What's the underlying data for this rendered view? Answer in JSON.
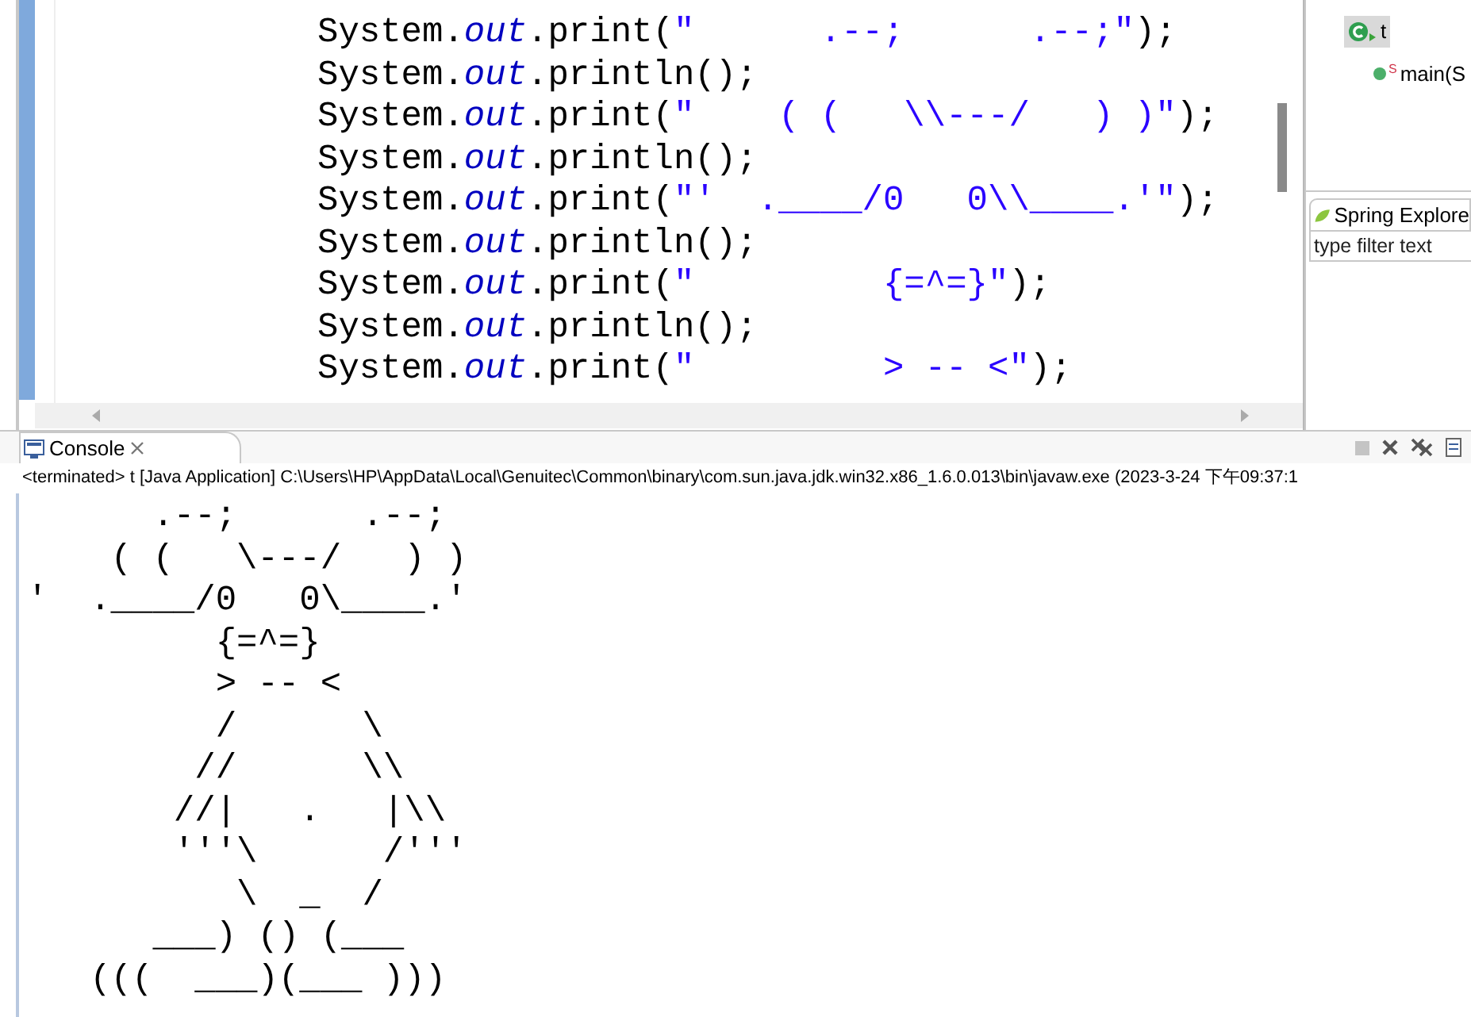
{
  "editor": {
    "lines": [
      {
        "kind": "print",
        "receiver": "System.",
        "field": "out",
        "method": ".print(",
        "literal": "\"      .--;      .--;\"",
        "end": ");"
      },
      {
        "kind": "println",
        "receiver": "System.",
        "field": "out",
        "method": ".println();"
      },
      {
        "kind": "print",
        "receiver": "System.",
        "field": "out",
        "method": ".print(",
        "literal": "\"    ( (   \\\\---/   ) )\"",
        "end": ");"
      },
      {
        "kind": "println",
        "receiver": "System.",
        "field": "out",
        "method": ".println();"
      },
      {
        "kind": "print",
        "receiver": "System.",
        "field": "out",
        "method": ".print(",
        "literal": "\"'  .____/0   0\\\\____.'\"",
        "end": ");"
      },
      {
        "kind": "println",
        "receiver": "System.",
        "field": "out",
        "method": ".println();"
      },
      {
        "kind": "print",
        "receiver": "System.",
        "field": "out",
        "method": ".print(",
        "literal": "\"         {=^=}\"",
        "end": ");"
      },
      {
        "kind": "println",
        "receiver": "System.",
        "field": "out",
        "method": ".println();"
      },
      {
        "kind": "print",
        "receiver": "System.",
        "field": "out",
        "method": ".print(",
        "literal": "\"         > -- <\"",
        "end": ");"
      }
    ]
  },
  "outline": {
    "items": [
      {
        "label": "t",
        "kind": "class",
        "selected": true,
        "children": [
          {
            "label": "main(S",
            "kind": "method",
            "static_mark": "S",
            "selected": false
          }
        ]
      }
    ]
  },
  "spring_explorer": {
    "tab": "Spring Explore",
    "filter": {
      "placeholder": "type filter text"
    }
  },
  "console": {
    "tab": "Console",
    "status": "<terminated> t [Java Application] C:\\Users\\HP\\AppData\\Local\\Genuitec\\Common\\binary\\com.sun.java.jdk.win32.x86_1.6.0.013\\bin\\javaw.exe (2023-3-24 下午09:37:1",
    "output": [
      "      .--;      .--;",
      "    ( (   \\---/   ) )",
      "'  .____/0   0\\____.'",
      "         {=^=}",
      "         > -- <",
      "         /      \\",
      "        //      \\\\",
      "       //|   .   |\\\\",
      "       '''\\      /'''",
      "          \\  _  /",
      "      ___) () (___",
      "   (((  ___)(___ )))"
    ]
  }
}
